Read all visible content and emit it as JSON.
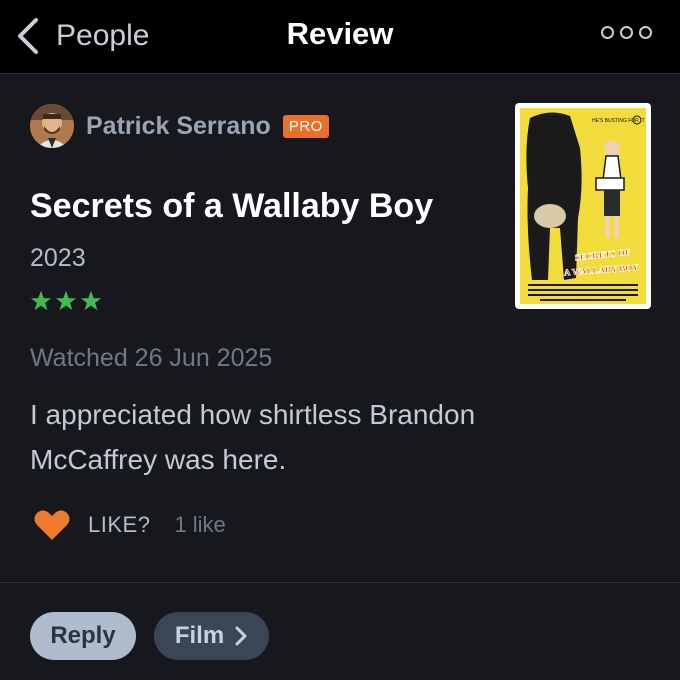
{
  "header": {
    "back_label": "People",
    "title": "Review",
    "back_icon": "chevron-left-icon",
    "more_icon": "more-options-icon"
  },
  "author": {
    "name": "Patrick Serrano",
    "badge": "PRO"
  },
  "film": {
    "title": "Secrets of a Wallaby Boy",
    "year": "2023",
    "rating_stars": 3,
    "poster": {
      "tagline": "HE'S BUSTING FOR IT",
      "title_line1": "SECRETS OF",
      "title_line2": "A WALLABY BOY"
    }
  },
  "review": {
    "watched": "Watched 26 Jun 2025",
    "text": "I appreciated how shirtless Brandon McCaffrey was here."
  },
  "likes": {
    "prompt": "LIKE?",
    "count": "1 like"
  },
  "actions": {
    "reply_label": "Reply",
    "film_label": "Film"
  },
  "colors": {
    "background": "#16181d",
    "header_bg": "#000000",
    "star_green": "#40bc53",
    "heart_orange": "#ee7b2e",
    "pro_badge": "#e8702a",
    "poster_yellow": "#f2dc3c"
  }
}
